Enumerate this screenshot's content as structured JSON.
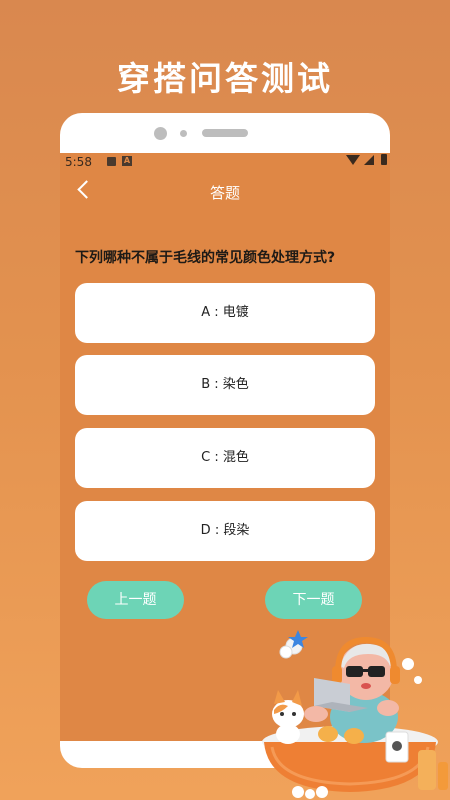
{
  "banner": {
    "title": "穿搭问答测试"
  },
  "status_bar": {
    "time": "5:58",
    "notif_icon": "A"
  },
  "nav": {
    "back_icon": "chevron-left-icon",
    "title": "答题"
  },
  "quiz": {
    "question": "下列哪种不属于毛线的常见颜色处理方式?",
    "options": [
      {
        "label": "A : 电镀"
      },
      {
        "label": "B : 染色"
      },
      {
        "label": "C : 混色"
      },
      {
        "label": "D : 段染"
      }
    ],
    "prev_label": "上一题",
    "next_label": "下一题"
  },
  "colors": {
    "background": "#e3924f",
    "screen": "#df8745",
    "option_bg": "#ffffff",
    "button": "#6dd4b6"
  }
}
